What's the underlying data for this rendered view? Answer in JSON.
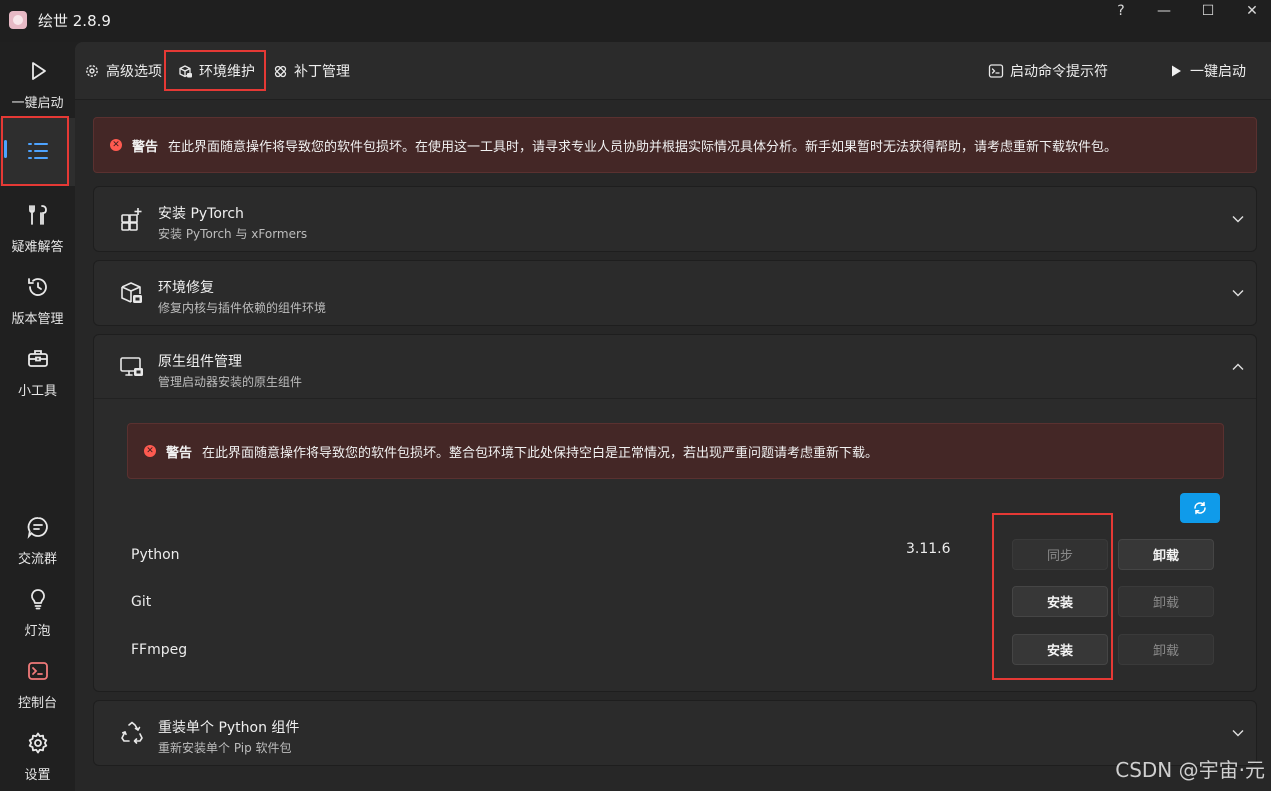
{
  "app": {
    "title": "绘世 2.8.9"
  },
  "window_controls": {
    "help": "?",
    "minimize": "—",
    "maximize": "☐",
    "close": "✕"
  },
  "sidebar": {
    "items": [
      {
        "label": "一键启动",
        "icon": "play-icon"
      },
      {
        "label": "",
        "icon": "list-icon"
      },
      {
        "label": "疑难解答",
        "icon": "tools-icon"
      },
      {
        "label": "版本管理",
        "icon": "history-icon"
      },
      {
        "label": "小工具",
        "icon": "toolbox-icon"
      },
      {
        "label": "交流群",
        "icon": "chat-icon"
      },
      {
        "label": "灯泡",
        "icon": "lightbulb-icon"
      },
      {
        "label": "控制台",
        "icon": "console-icon"
      },
      {
        "label": "设置",
        "icon": "gear-icon"
      }
    ]
  },
  "tabs": [
    {
      "label": "高级选项",
      "icon": "settings-icon"
    },
    {
      "label": "环境维护",
      "icon": "package-icon"
    },
    {
      "label": "补丁管理",
      "icon": "bandage-icon"
    }
  ],
  "actions": {
    "cmd_label": "启动命令提示符",
    "launch_label": "一键启动"
  },
  "top_warning": {
    "title": "警告",
    "text": "在此界面随意操作将导致您的软件包损坏。在使用这一工具时，请寻求专业人员协助并根据实际情况具体分析。新手如果暂时无法获得帮助，请考虑重新下载软件包。"
  },
  "cards": [
    {
      "title": "安装 PyTorch",
      "subtitle": "安装 PyTorch 与 xFormers",
      "icon": "grid-add-icon"
    },
    {
      "title": "环境修复",
      "subtitle": "修复内核与插件依赖的组件环境",
      "icon": "box-repair-icon"
    },
    {
      "title": "原生组件管理",
      "subtitle": "管理启动器安装的原生组件",
      "icon": "monitor-package-icon"
    },
    {
      "title": "重装单个 Python 组件",
      "subtitle": "重新安装单个 Pip 软件包",
      "icon": "recycle-icon"
    }
  ],
  "inner_warning": {
    "title": "警告",
    "text": "在此界面随意操作将导致您的软件包损坏。整合包环境下此处保持空白是正常情况，若出现严重问题请考虑重新下载。"
  },
  "components": [
    {
      "name": "Python",
      "version": "3.11.6",
      "primary": "同步",
      "primary_enabled": false,
      "secondary": "卸载",
      "secondary_enabled": true
    },
    {
      "name": "Git",
      "version": "",
      "primary": "安装",
      "primary_enabled": true,
      "secondary": "卸载",
      "secondary_enabled": false
    },
    {
      "name": "FFmpeg",
      "version": "",
      "primary": "安装",
      "primary_enabled": true,
      "secondary": "卸载",
      "secondary_enabled": false
    }
  ],
  "watermark": "CSDN @宇宙·元",
  "colors": {
    "accent": "#0f9bea",
    "highlight": "#e53935",
    "warning_bg": "#442726",
    "error_icon": "#ff5a50"
  }
}
